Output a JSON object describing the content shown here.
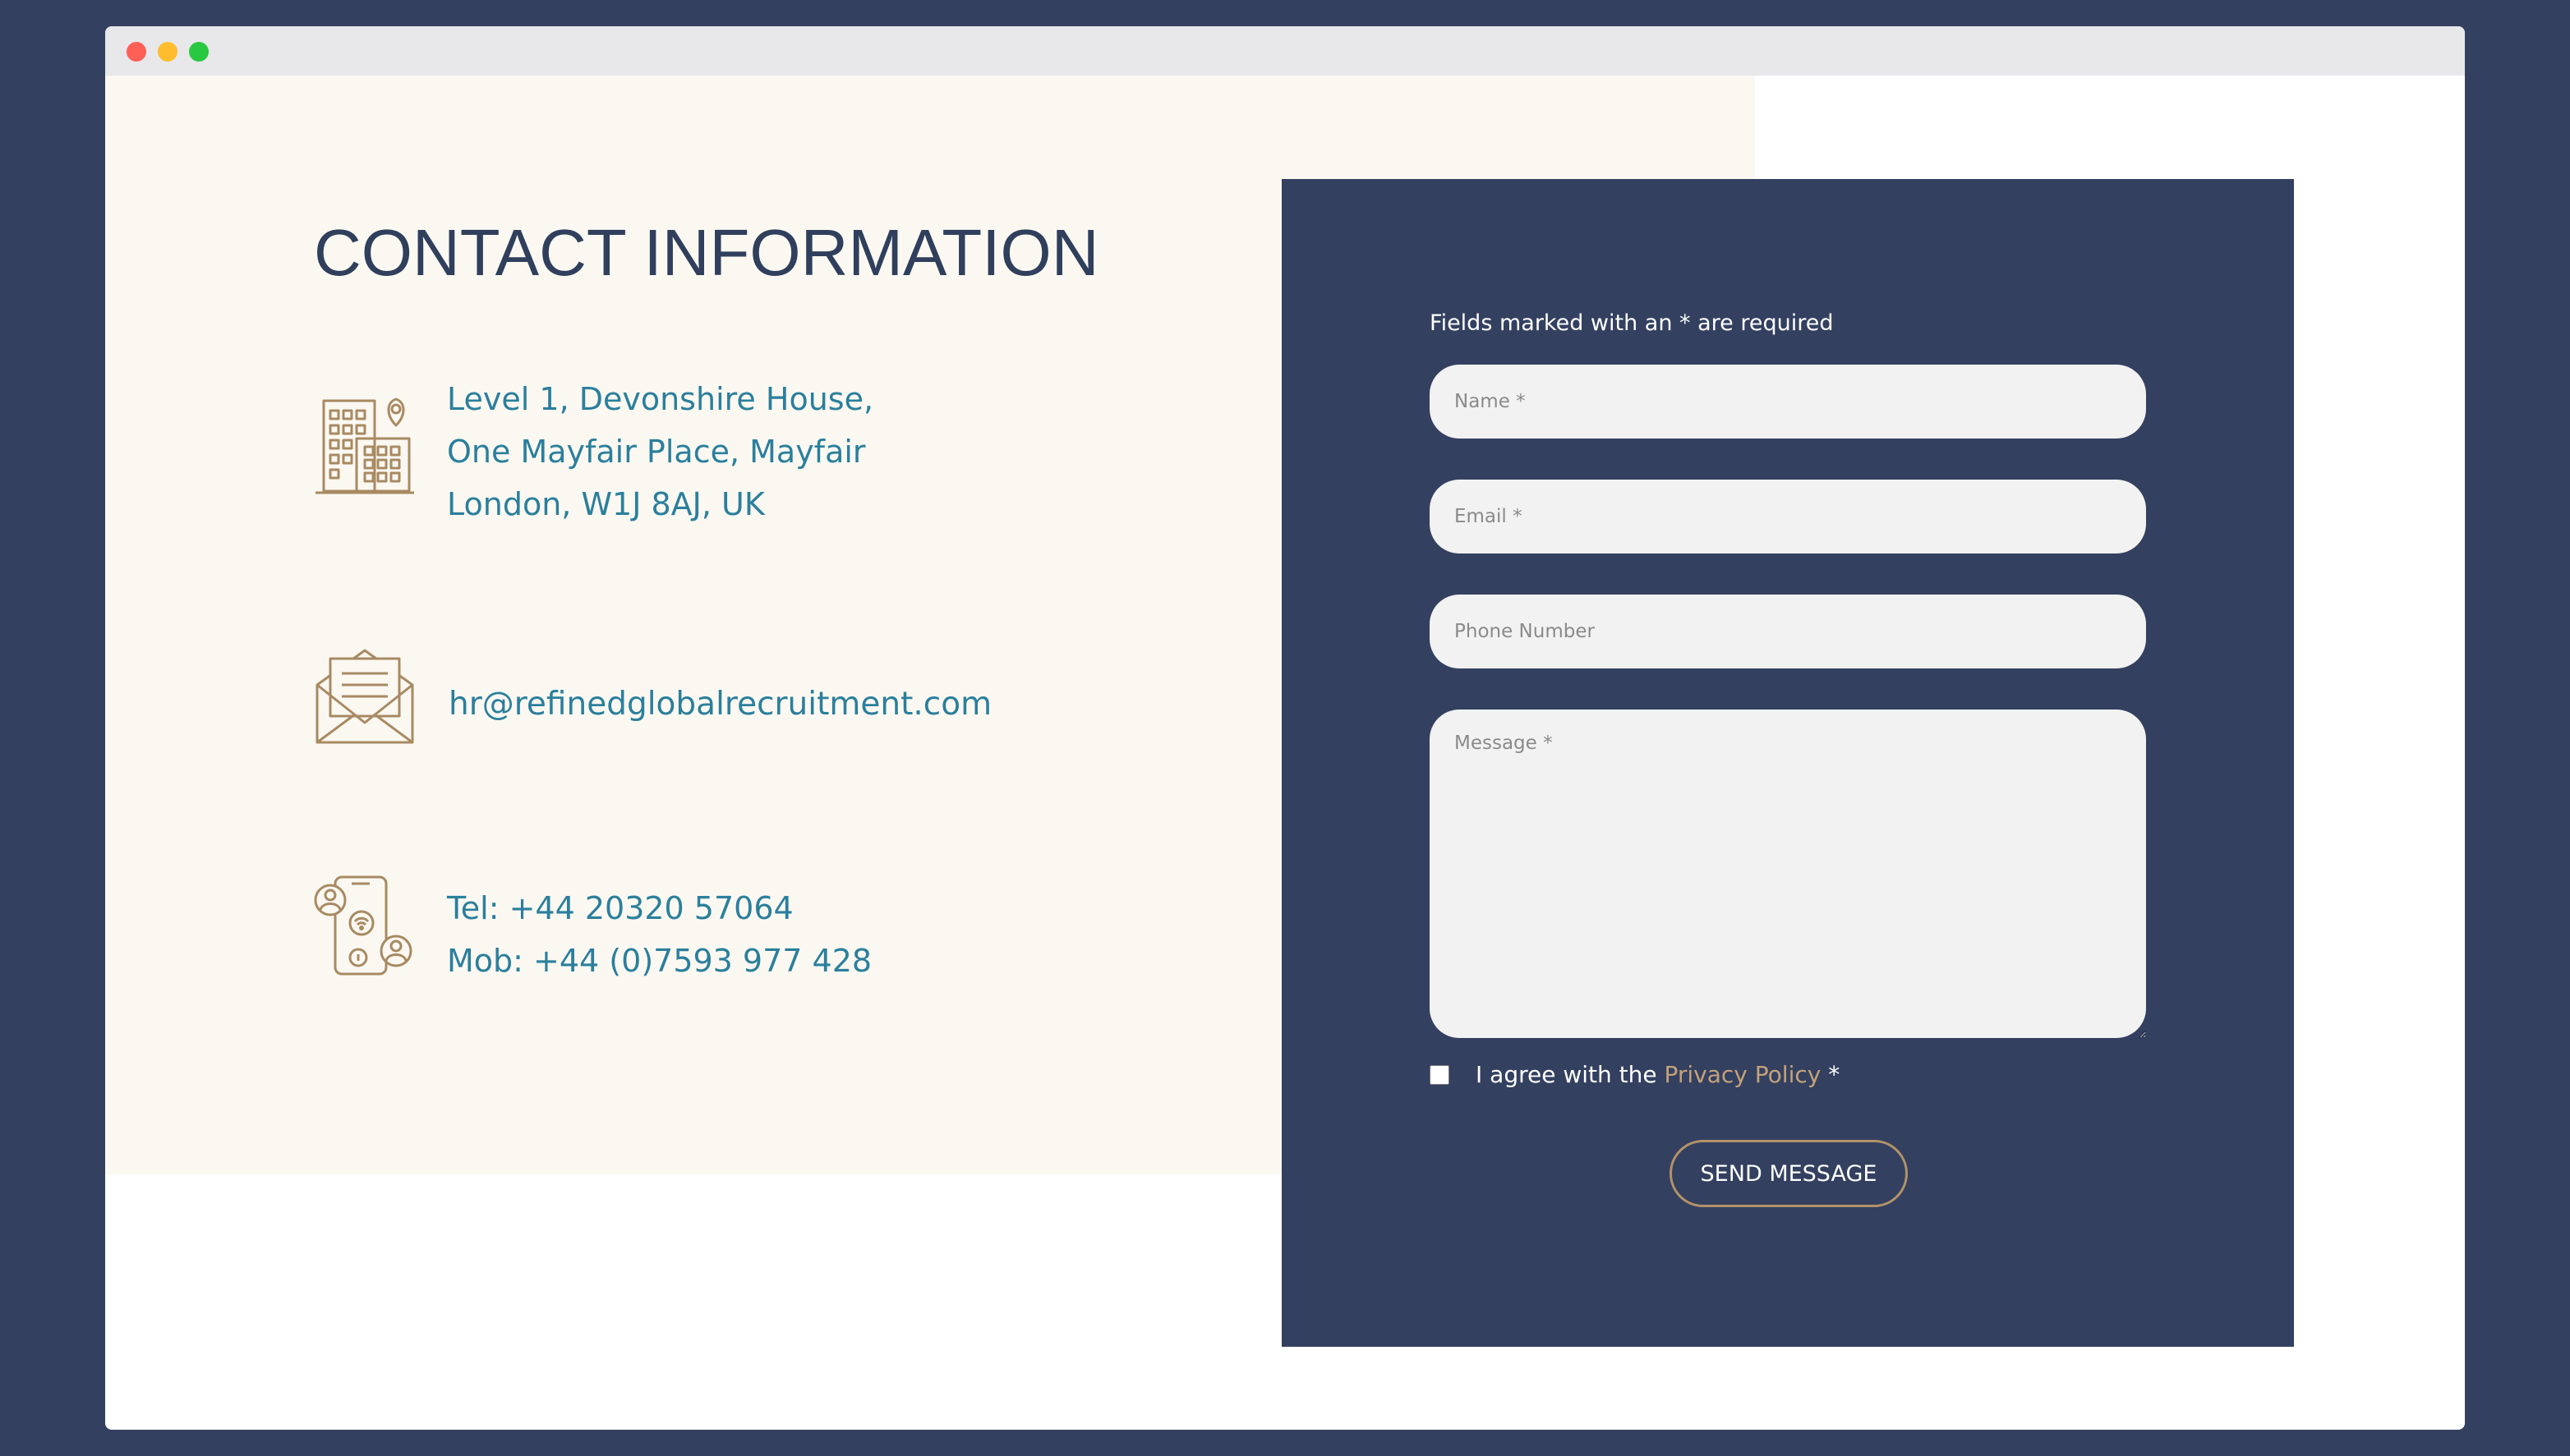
{
  "window": {
    "buttons": [
      "close",
      "minimize",
      "maximize"
    ]
  },
  "contact": {
    "title": "CONTACT INFORMATION",
    "address_lines": [
      "Level 1, Devonshire House,",
      "One Mayfair Place, Mayfair",
      "London, W1J 8AJ, UK"
    ],
    "email": "hr@refinedglobalrecruitment.com",
    "tel": "Tel: +44 20320 57064",
    "mob": "Mob: +44 (0)7593 977 428",
    "icons": [
      "building-location-icon",
      "envelope-letter-icon",
      "phone-contacts-icon"
    ]
  },
  "form": {
    "required_note": "Fields marked with an * are required",
    "name_placeholder": "Name *",
    "email_placeholder": "Email *",
    "phone_placeholder": "Phone Number",
    "message_placeholder": "Message *",
    "agree_prefix": "I agree with the ",
    "privacy_link": "Privacy Policy",
    "agree_suffix": " *",
    "agree_checked": false,
    "send_label": "SEND MESSAGE"
  },
  "colors": {
    "navy": "#334060",
    "accent_blue": "#2b7f9c",
    "gold": "#b39268",
    "cream": "#fbf8f2"
  }
}
